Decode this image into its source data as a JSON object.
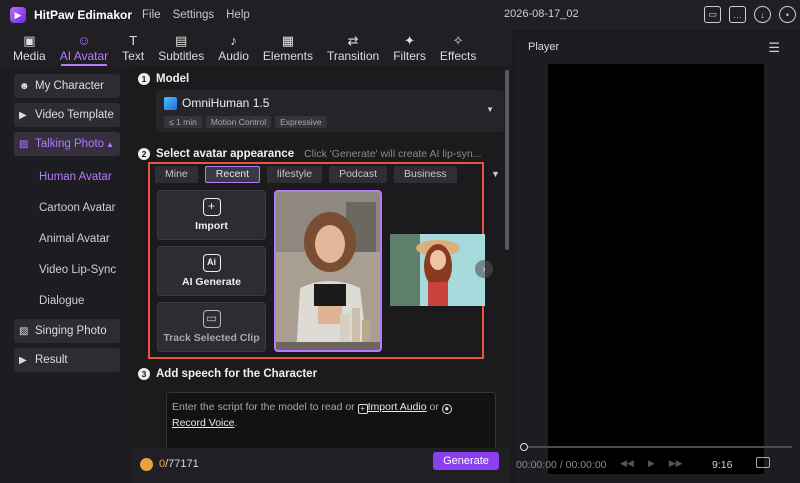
{
  "app": {
    "name": "HitPaw Edimakor",
    "menu": [
      "File",
      "Settings",
      "Help"
    ],
    "project": "2026-08-17_02"
  },
  "toolbar": {
    "tabs": [
      {
        "label": "Media",
        "icon": "media-icon",
        "glyph": "▣"
      },
      {
        "label": "AI Avatar",
        "icon": "avatar-icon",
        "glyph": "☺"
      },
      {
        "label": "Text",
        "icon": "text-icon",
        "glyph": "T"
      },
      {
        "label": "Subtitles",
        "icon": "subtitles-icon",
        "glyph": "▤"
      },
      {
        "label": "Audio",
        "icon": "music-icon",
        "glyph": "♪"
      },
      {
        "label": "Elements",
        "icon": "elements-icon",
        "glyph": "▦"
      },
      {
        "label": "Transition",
        "icon": "transition-icon",
        "glyph": "⇄"
      },
      {
        "label": "Filters",
        "icon": "filters-icon",
        "glyph": "✦"
      },
      {
        "label": "Effects",
        "icon": "effects-icon",
        "glyph": "✧"
      }
    ],
    "active": "AI Avatar"
  },
  "sidebar": {
    "items": [
      {
        "label": "My Character",
        "glyph": "☻"
      },
      {
        "label": "Video Template",
        "glyph": "▶"
      },
      {
        "label": "Talking Photo",
        "glyph": "▨"
      },
      {
        "label": "Singing Photo",
        "glyph": "▨"
      },
      {
        "label": "Result",
        "glyph": "▶"
      }
    ],
    "sub_items": [
      "Human Avatar",
      "Cartoon Avatar",
      "Animal Avatar",
      "Video Lip-Sync",
      "Dialogue"
    ]
  },
  "model": {
    "section_number": "1",
    "section_title": "Model",
    "name": "OmniHuman 1.5",
    "chips": [
      "≤ 1 min",
      "Motion Control",
      "Expressive"
    ]
  },
  "appearance": {
    "section_number": "2",
    "section_title": "Select avatar appearance",
    "hint": "Click 'Generate' will create AI lip-syn...",
    "categories": [
      "Mine",
      "Recent",
      "lifestyle",
      "Podcast",
      "Business"
    ],
    "active_category": "Recent",
    "cards": [
      {
        "label": "Import",
        "glyph": "+"
      },
      {
        "label": "AI Generate",
        "glyph": "Ai"
      },
      {
        "label": "Track Selected Clip",
        "glyph": "▭"
      }
    ]
  },
  "speech": {
    "section_number": "3",
    "section_title": "Add speech for the Character",
    "prefix": "Enter the script for the model to read or",
    "import_audio": "Import Audio",
    "or": "or",
    "record_voice": "Record Voice",
    "suffix": "."
  },
  "footer": {
    "credits_used": "0",
    "credits_total": "/77171",
    "generate_label": "Generate"
  },
  "player": {
    "title": "Player",
    "timecode": "00:00:00 / 00:00:00",
    "duration": "9:16"
  }
}
